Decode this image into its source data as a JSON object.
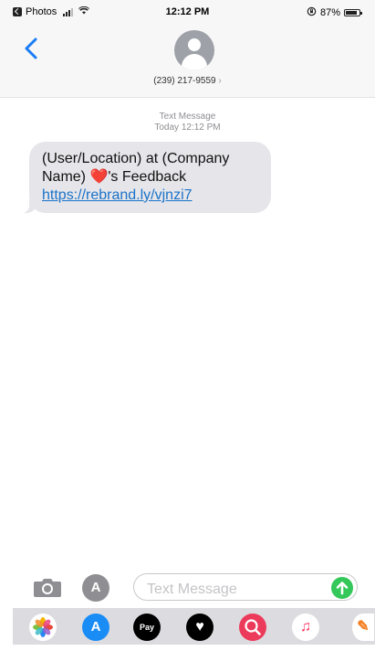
{
  "status_bar": {
    "back_app": "Photos",
    "time": "12:12 PM",
    "battery": "87%",
    "battery_level": 0.87,
    "lock_icon": "rotation-lock-icon"
  },
  "header": {
    "contact_number": "(239) 217-9559",
    "chevron": "›"
  },
  "thread": {
    "message_type": "Text Message",
    "timestamp": "Today 12:12 PM",
    "messages": [
      {
        "text_before": "(User/Location) at (Company Name) ",
        "emoji": "❤️",
        "text_after": "'s Feedback ",
        "link": "https://rebrand.ly/vjnzi7"
      }
    ]
  },
  "composer": {
    "placeholder": "Text Message"
  },
  "app_drawer": {
    "apps": [
      {
        "name": "photos-app-icon"
      },
      {
        "name": "app-store-icon"
      },
      {
        "name": "apple-pay-icon",
        "label": "Pay"
      },
      {
        "name": "digital-touch-icon"
      },
      {
        "name": "images-search-icon"
      },
      {
        "name": "music-icon"
      },
      {
        "name": "app-extension-icon"
      }
    ]
  },
  "colors": {
    "accent": "#1a73c8",
    "incoming_bubble": "#e5e5ea",
    "send_button": "#34c759"
  }
}
